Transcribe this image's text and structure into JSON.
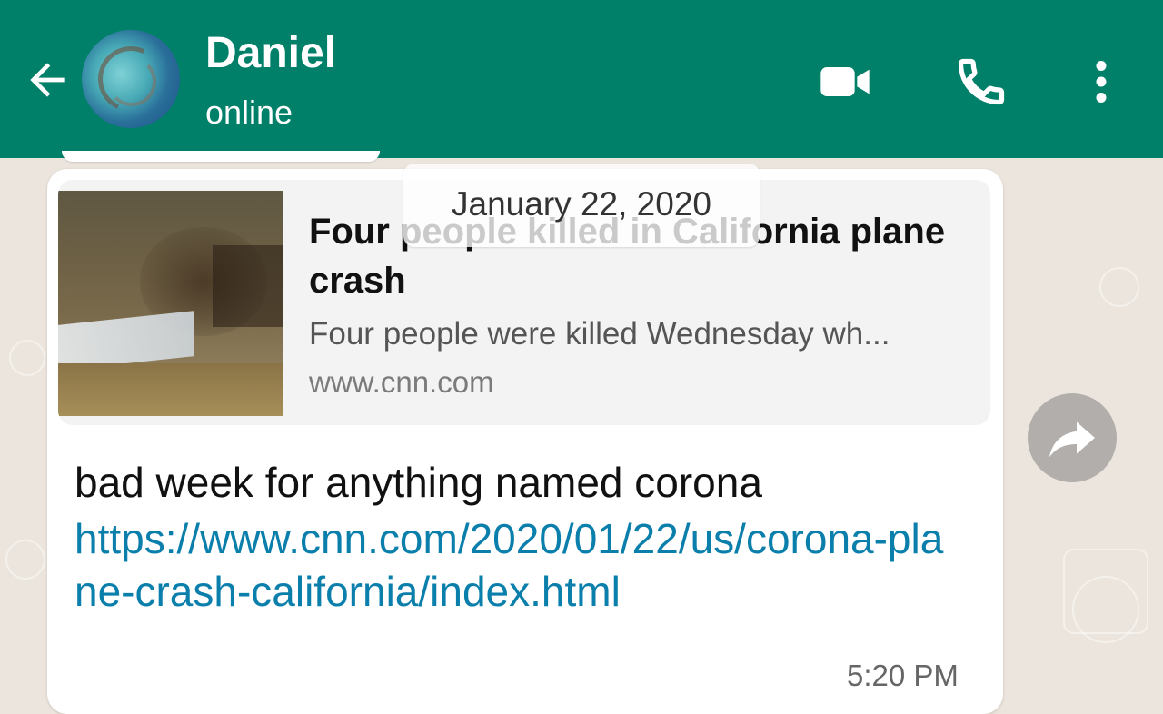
{
  "header": {
    "contact_name": "Daniel",
    "contact_status": "online",
    "background_color": "#008069",
    "icons": {
      "back": "arrow-left-icon",
      "video": "video-camera-icon",
      "call": "phone-icon",
      "menu": "more-vertical-icon"
    }
  },
  "date_chip": {
    "label": "January 22, 2020"
  },
  "message": {
    "preview": {
      "title": "Four people killed in California plane crash",
      "description": "Four people were killed Wednesday wh...",
      "domain": "www.cnn.com"
    },
    "text": "bad week for anything named corona",
    "link": "https://www.cnn.com/2020/01/22/us/corona-plane-crash-california/index.html",
    "time": "5:20 PM"
  },
  "forward": {
    "icon": "forward-arrow-icon"
  }
}
